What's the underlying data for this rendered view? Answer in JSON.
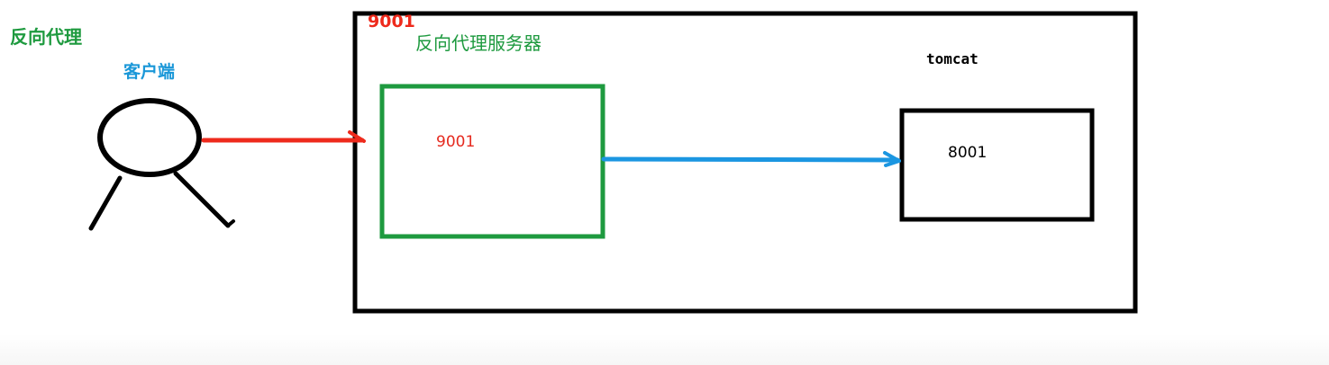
{
  "diagram": {
    "title": "反向代理",
    "client_label": "客户端",
    "outer_box_port": "9001",
    "proxy_server_label": "反向代理服务器",
    "proxy_box_port": "9001",
    "tomcat_label": "tomcat",
    "tomcat_box_port": "8001"
  },
  "colors": {
    "green": "#1e9a3f",
    "red": "#ee2a1c",
    "blue": "#1b96e1",
    "black": "#000000",
    "client_label_blue": "#1a97d8",
    "proxy_port_red": "#e52a1f"
  },
  "arrows": [
    {
      "from": "client",
      "to": "reverse-proxy-server",
      "color": "red"
    },
    {
      "from": "reverse-proxy-server",
      "to": "tomcat",
      "color": "blue"
    }
  ]
}
